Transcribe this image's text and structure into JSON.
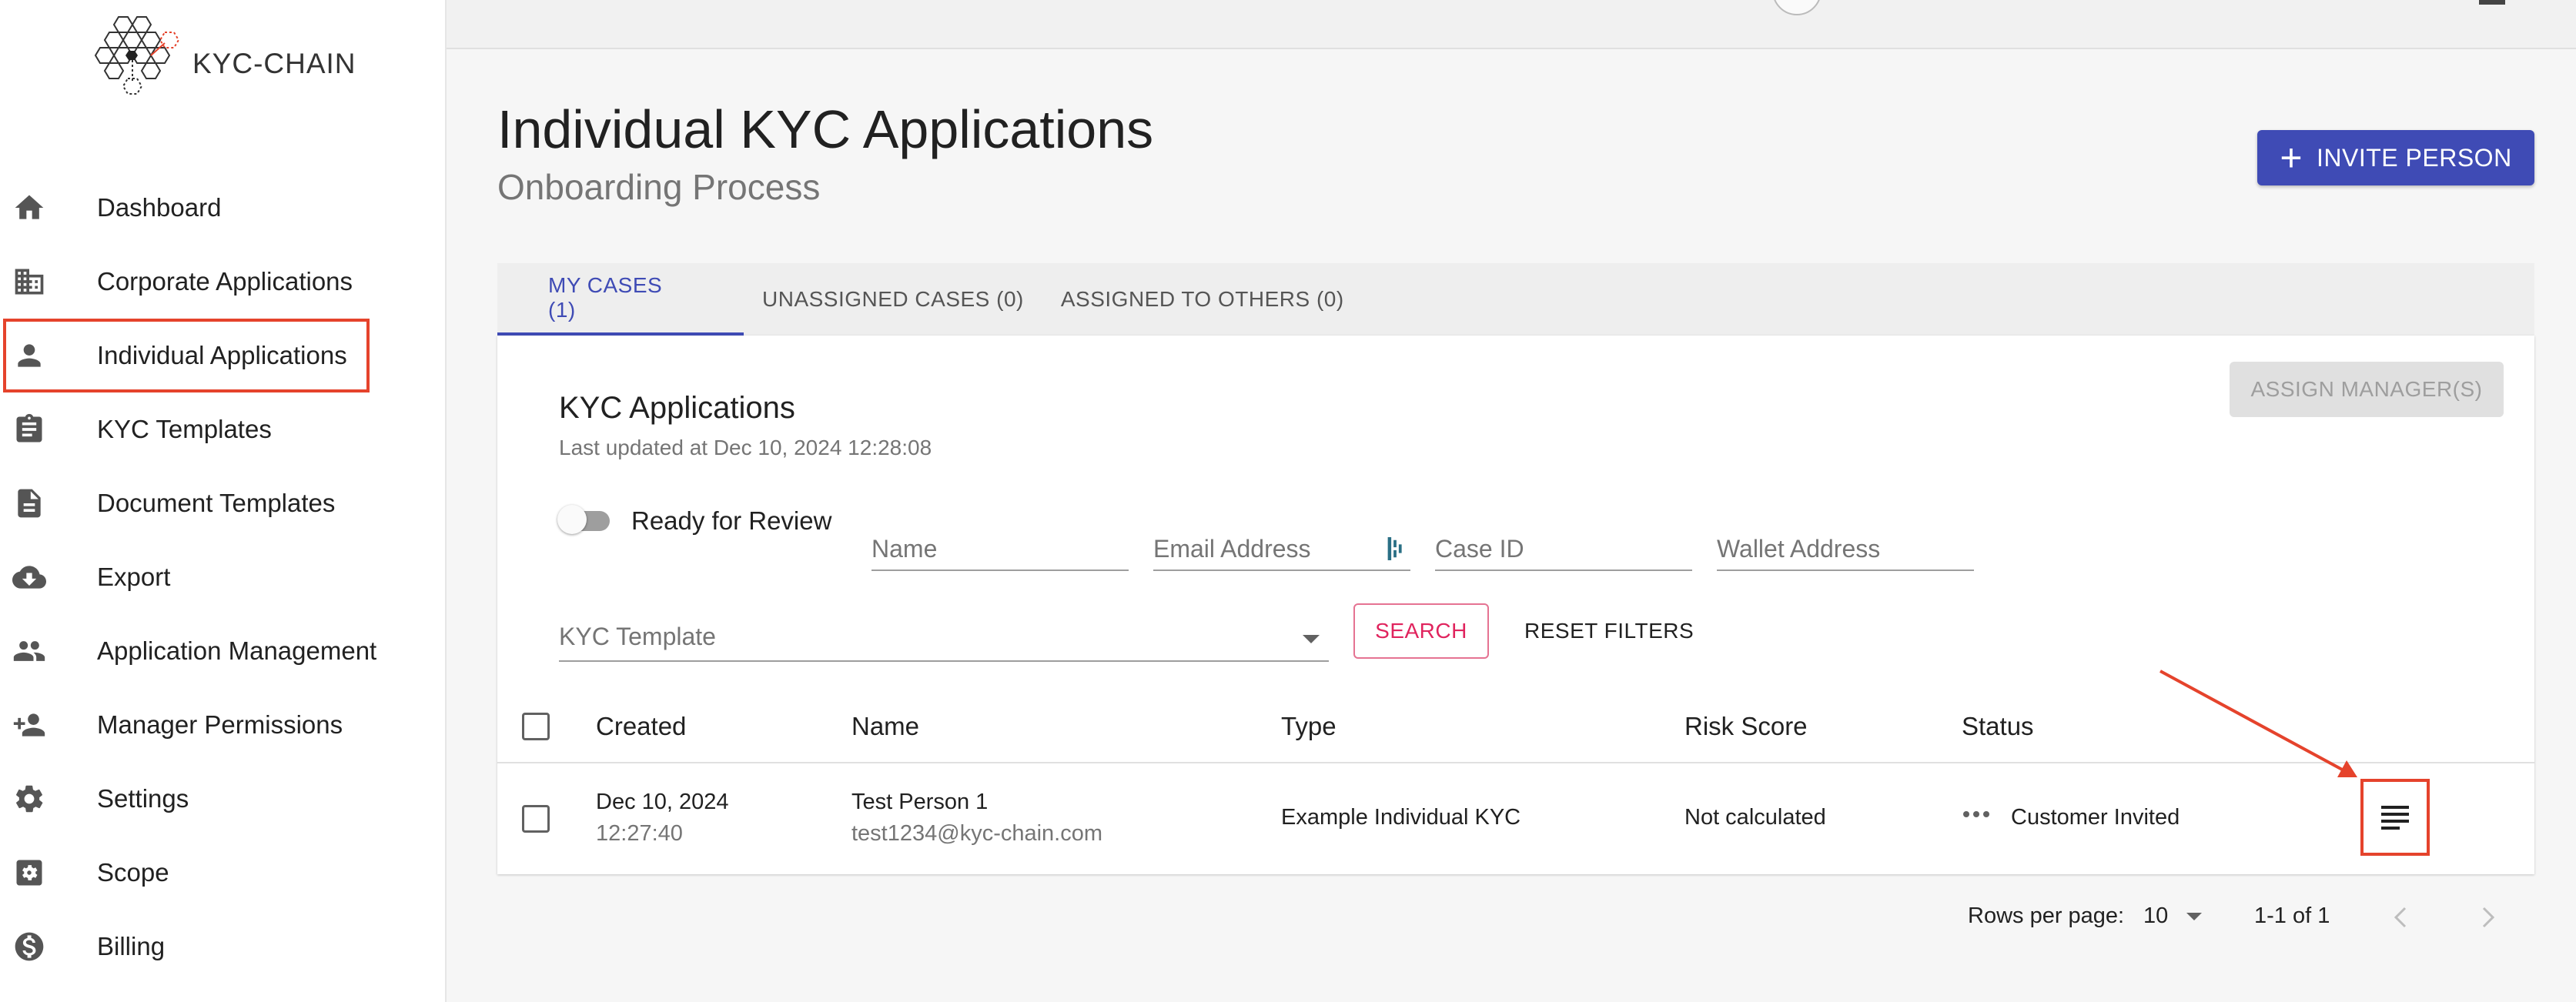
{
  "logo": {
    "text": "KYC-CHAIN"
  },
  "sidebar": {
    "items": [
      {
        "label": "Dashboard",
        "icon": "home-icon"
      },
      {
        "label": "Corporate Applications",
        "icon": "building-icon"
      },
      {
        "label": "Individual Applications",
        "icon": "person-icon"
      },
      {
        "label": "KYC Templates",
        "icon": "clipboard-icon"
      },
      {
        "label": "Document Templates",
        "icon": "document-icon"
      },
      {
        "label": "Export",
        "icon": "cloud-download-icon"
      },
      {
        "label": "Application Management",
        "icon": "people-icon"
      },
      {
        "label": "Manager Permissions",
        "icon": "person-add-icon"
      },
      {
        "label": "Settings",
        "icon": "gear-icon"
      },
      {
        "label": "Scope",
        "icon": "scope-icon"
      },
      {
        "label": "Billing",
        "icon": "dollar-icon"
      }
    ]
  },
  "header": {
    "title": "Individual KYC Applications",
    "subtitle": "Onboarding Process",
    "invite_label": "INVITE PERSON"
  },
  "tabs": [
    {
      "label": "MY CASES (1)"
    },
    {
      "label": "UNASSIGNED CASES (0)"
    },
    {
      "label": "ASSIGNED TO OTHERS (0)"
    }
  ],
  "card": {
    "title": "KYC Applications",
    "updated": "Last updated at Dec 10, 2024 12:28:08",
    "assign_label": "ASSIGN MANAGER(S)"
  },
  "filters": {
    "ready_label": "Ready for Review",
    "name_placeholder": "Name",
    "email_placeholder": "Email Address",
    "case_placeholder": "Case ID",
    "wallet_placeholder": "Wallet Address",
    "template_placeholder": "KYC Template",
    "search_label": "SEARCH",
    "reset_label": "RESET FILTERS"
  },
  "table": {
    "columns": [
      "Created",
      "Name",
      "Type",
      "Risk Score",
      "Status"
    ],
    "rows": [
      {
        "date": "Dec 10, 2024",
        "time": "12:27:40",
        "name": "Test Person 1",
        "email": "test1234@kyc-chain.com",
        "type": "Example Individual KYC",
        "risk": "Not calculated",
        "status": "Customer Invited"
      }
    ]
  },
  "pagination": {
    "rows_label": "Rows per page:",
    "rows_value": "10",
    "range": "1-1 of 1"
  },
  "colors": {
    "primary": "#3f4bb5",
    "highlight": "#e5432c",
    "search": "#e0245e"
  }
}
